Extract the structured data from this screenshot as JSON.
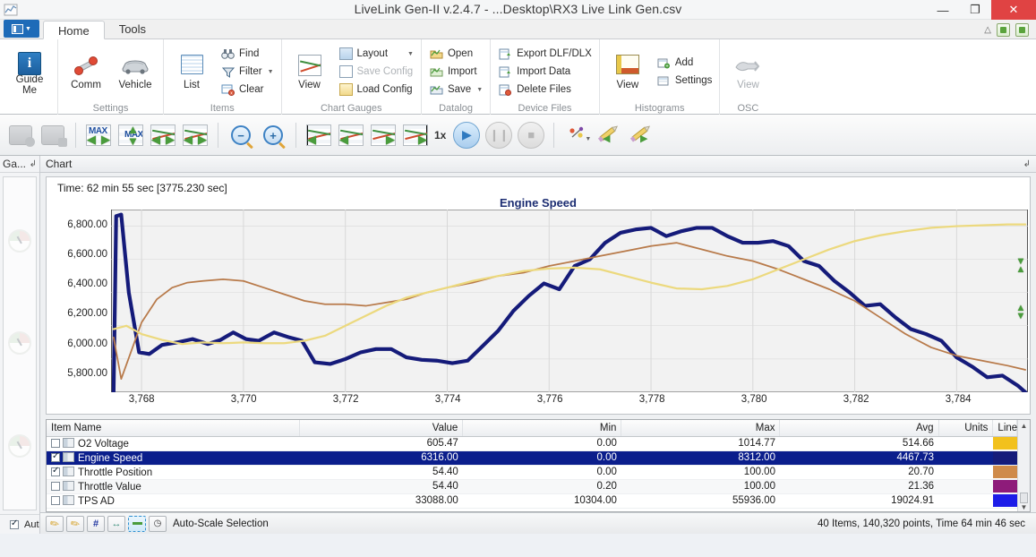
{
  "window": {
    "title": "LiveLink Gen-II  v.2.4.7 - ...Desktop\\RX3 Live Link Gen.csv",
    "minimize": "—",
    "maximize": "❐",
    "close": "✕"
  },
  "tabs": [
    {
      "label": "Home",
      "active": true
    },
    {
      "label": "Tools",
      "active": false
    }
  ],
  "ribbon": {
    "groups": [
      {
        "title": "",
        "big": [
          {
            "label": "Guide\nMe",
            "line1": "Guide",
            "line2": "Me",
            "icon": "info-icon",
            "dim": false
          }
        ],
        "small": []
      },
      {
        "title": "Settings",
        "big": [
          {
            "line1": "Comm",
            "line2": "",
            "icon": "connector-icon",
            "dim": false
          },
          {
            "line1": "Vehicle",
            "line2": "",
            "icon": "car-icon",
            "dim": false
          }
        ],
        "small": []
      },
      {
        "title": "Items",
        "big": [
          {
            "line1": "List",
            "line2": "",
            "icon": "list-icon",
            "dim": false
          }
        ],
        "small": [
          {
            "label": "Find",
            "icon": "binoculars-icon",
            "dim": false,
            "caret": false
          },
          {
            "label": "Filter",
            "icon": "funnel-icon",
            "dim": false,
            "caret": true
          },
          {
            "label": "Clear",
            "icon": "clear-icon",
            "dim": false,
            "caret": false
          }
        ]
      },
      {
        "title": "Chart  Gauges",
        "big": [
          {
            "line1": "View",
            "line2": "",
            "icon": "chart-view-icon",
            "dim": false
          }
        ],
        "small": [
          {
            "label": "Layout",
            "icon": "layout-icon",
            "dim": false,
            "caret": true
          },
          {
            "label": "Save Config",
            "icon": "save-config-icon",
            "dim": true,
            "caret": false
          },
          {
            "label": "Load Config",
            "icon": "load-config-icon",
            "dim": false,
            "caret": false
          }
        ]
      },
      {
        "title": "Datalog",
        "big": [],
        "small": [
          {
            "label": "Open",
            "icon": "open-icon",
            "dim": false,
            "caret": false
          },
          {
            "label": "Import",
            "icon": "import-icon",
            "dim": false,
            "caret": false
          },
          {
            "label": "Save",
            "icon": "save-icon",
            "dim": false,
            "caret": true
          }
        ]
      },
      {
        "title": "Device Files",
        "big": [],
        "small": [
          {
            "label": "Export DLF/DLX",
            "icon": "export-icon",
            "dim": false,
            "caret": false
          },
          {
            "label": "Import Data",
            "icon": "import-data-icon",
            "dim": false,
            "caret": false
          },
          {
            "label": "Delete Files",
            "icon": "delete-files-icon",
            "dim": false,
            "caret": false
          }
        ]
      },
      {
        "title": "Histograms",
        "big": [
          {
            "line1": "View",
            "line2": "",
            "icon": "histogram-icon",
            "dim": false
          }
        ],
        "small": [
          {
            "label": "Add",
            "icon": "add-icon",
            "dim": false,
            "caret": false
          },
          {
            "label": "Settings",
            "icon": "settings-icon",
            "dim": false,
            "caret": false
          }
        ]
      },
      {
        "title": "OSC",
        "big": [
          {
            "line1": "View",
            "line2": "",
            "icon": "osc-icon",
            "dim": true
          }
        ],
        "small": []
      }
    ]
  },
  "toolbar2": {
    "speed_label": "1x",
    "buttons": [
      "device-left-icon",
      "device-right-icon",
      "max-left-right-icon",
      "max-updown-icon",
      "chart-left-right-icon",
      "chart-expand-icon",
      "zoom-out-icon",
      "zoom-in-icon",
      "chart-start-icon",
      "chart-prev-icon",
      "chart-next-icon",
      "chart-end-icon",
      "play-icon",
      "pause-icon",
      "stop-icon",
      "marker-icon",
      "pencil-left-icon",
      "pencil-right-icon"
    ]
  },
  "gauges_panel": {
    "title": "Ga...",
    "pin": "↲",
    "auto_label": "Aut",
    "auto_checked": true
  },
  "chart_dock": {
    "title": "Chart",
    "pin": "↲"
  },
  "chart_data": {
    "type": "line",
    "title": "Engine Speed",
    "time_label": "Time: 62 min 55 sec [3775.230 sec]",
    "xlabel": "",
    "ylabel": "",
    "grid": true,
    "legend": "none",
    "ylim": [
      5800,
      6900
    ],
    "ytick_labels": [
      "6,800.00",
      "6,600.00",
      "6,400.00",
      "6,200.00",
      "6,000.00",
      "5,800.00"
    ],
    "ytick_values": [
      6800,
      6600,
      6400,
      6200,
      6000,
      5800
    ],
    "xlim": [
      3767.4,
      3785.4
    ],
    "xtick_labels": [
      "3,768",
      "3,770",
      "3,772",
      "3,774",
      "3,776",
      "3,778",
      "3,780",
      "3,782",
      "3,784"
    ],
    "xtick_values": [
      3768,
      3770,
      3772,
      3774,
      3776,
      3778,
      3780,
      3782,
      3784
    ],
    "series": [
      {
        "name": "Engine Speed",
        "color": "#151b7a",
        "width": 2.6,
        "x": [
          3767.45,
          3767.5,
          3767.6,
          3767.75,
          3767.95,
          3768.15,
          3768.4,
          3768.7,
          3769.0,
          3769.3,
          3769.55,
          3769.8,
          3770.05,
          3770.3,
          3770.6,
          3770.9,
          3771.15,
          3771.4,
          3771.7,
          3772.0,
          3772.3,
          3772.6,
          3772.9,
          3773.2,
          3773.5,
          3773.8,
          3774.1,
          3774.4,
          3774.7,
          3775.0,
          3775.3,
          3775.6,
          3775.9,
          3776.2,
          3776.5,
          3776.8,
          3777.1,
          3777.4,
          3777.7,
          3778.0,
          3778.3,
          3778.6,
          3778.9,
          3779.2,
          3779.5,
          3779.8,
          3780.1,
          3780.4,
          3780.7,
          3781.0,
          3781.3,
          3781.6,
          3781.9,
          3782.2,
          3782.5,
          3782.8,
          3783.1,
          3783.4,
          3783.7,
          3784.0,
          3784.3,
          3784.6,
          3784.9,
          3785.2,
          3785.35
        ],
        "y": [
          5800,
          6860,
          6870,
          6400,
          6040,
          6030,
          6085,
          6100,
          6120,
          6090,
          6115,
          6160,
          6120,
          6110,
          6160,
          6130,
          6110,
          5980,
          5970,
          6000,
          6040,
          6060,
          6060,
          6010,
          5995,
          5990,
          5975,
          5990,
          6080,
          6170,
          6290,
          6380,
          6455,
          6420,
          6560,
          6600,
          6700,
          6760,
          6780,
          6790,
          6740,
          6770,
          6790,
          6790,
          6740,
          6700,
          6700,
          6710,
          6680,
          6590,
          6560,
          6470,
          6400,
          6320,
          6330,
          6250,
          6180,
          6150,
          6110,
          6010,
          5955,
          5890,
          5900,
          5840,
          5800
        ]
      },
      {
        "name": "Throttle Position",
        "color": "#b87a4a",
        "width": 1.1,
        "x": [
          3767.45,
          3767.6,
          3767.8,
          3768.0,
          3768.3,
          3768.6,
          3768.9,
          3769.2,
          3769.6,
          3770.0,
          3770.4,
          3770.8,
          3771.2,
          3771.6,
          3772.0,
          3772.4,
          3772.8,
          3773.2,
          3773.6,
          3774.0,
          3774.5,
          3775.0,
          3775.5,
          3776.0,
          3776.5,
          3777.0,
          3777.5,
          3778.0,
          3778.5,
          3779.0,
          3779.5,
          3780.0,
          3780.5,
          3781.0,
          3781.5,
          3782.0,
          3782.5,
          3783.0,
          3783.5,
          3784.0,
          3784.5,
          3785.0,
          3785.35
        ],
        "y": [
          6130,
          5880,
          6050,
          6220,
          6360,
          6430,
          6460,
          6470,
          6480,
          6470,
          6430,
          6390,
          6350,
          6330,
          6330,
          6320,
          6340,
          6360,
          6400,
          6430,
          6460,
          6500,
          6520,
          6560,
          6590,
          6620,
          6650,
          6680,
          6700,
          6660,
          6620,
          6590,
          6540,
          6480,
          6420,
          6350,
          6250,
          6150,
          6070,
          6020,
          5990,
          5960,
          5935
        ]
      },
      {
        "name": "Throttle Value",
        "color": "#ecd97e",
        "width": 1.4,
        "x": [
          3767.45,
          3767.7,
          3768.0,
          3768.4,
          3768.8,
          3769.2,
          3769.6,
          3770.0,
          3770.4,
          3770.8,
          3771.2,
          3771.6,
          3772.0,
          3772.4,
          3772.8,
          3773.2,
          3773.6,
          3774.0,
          3774.5,
          3775.0,
          3775.5,
          3776.0,
          3776.5,
          3777.0,
          3777.5,
          3778.0,
          3778.5,
          3779.0,
          3779.5,
          3780.0,
          3780.5,
          3781.0,
          3781.5,
          3782.0,
          3782.5,
          3783.0,
          3783.5,
          3784.0,
          3784.5,
          3785.0,
          3785.35
        ],
        "y": [
          6180,
          6200,
          6150,
          6115,
          6090,
          6100,
          6095,
          6100,
          6095,
          6095,
          6110,
          6140,
          6200,
          6260,
          6320,
          6370,
          6400,
          6430,
          6470,
          6500,
          6530,
          6545,
          6550,
          6540,
          6500,
          6460,
          6425,
          6420,
          6440,
          6480,
          6540,
          6600,
          6660,
          6710,
          6745,
          6770,
          6790,
          6800,
          6805,
          6810,
          6810
        ]
      }
    ]
  },
  "table": {
    "columns": [
      {
        "key": "name",
        "label": "Item Name",
        "align": "left"
      },
      {
        "key": "value",
        "label": "Value",
        "align": "right"
      },
      {
        "key": "min",
        "label": "Min",
        "align": "right"
      },
      {
        "key": "max",
        "label": "Max",
        "align": "right"
      },
      {
        "key": "avg",
        "label": "Avg",
        "align": "right"
      },
      {
        "key": "units",
        "label": "Units",
        "align": "right"
      },
      {
        "key": "line",
        "label": "Line",
        "align": "right"
      }
    ],
    "rows": [
      {
        "checked": false,
        "selected": false,
        "name": "O2 Voltage",
        "value": "605.47",
        "min": "0.00",
        "max": "1014.77",
        "avg": "514.66",
        "units": "",
        "color": "#f2c11c"
      },
      {
        "checked": true,
        "selected": true,
        "name": "Engine Speed",
        "value": "6316.00",
        "min": "0.00",
        "max": "8312.00",
        "avg": "4467.73",
        "units": "",
        "color": "#151b7a"
      },
      {
        "checked": true,
        "selected": false,
        "name": "Throttle Position",
        "value": "54.40",
        "min": "0.00",
        "max": "100.00",
        "avg": "20.70",
        "units": "",
        "color": "#cf8a4a"
      },
      {
        "checked": false,
        "selected": false,
        "name": "Throttle Value",
        "value": "54.40",
        "min": "0.20",
        "max": "100.00",
        "avg": "21.36",
        "units": "",
        "color": "#8e1b7a"
      },
      {
        "checked": false,
        "selected": false,
        "name": "TPS AD",
        "value": "33088.00",
        "min": "10304.00",
        "max": "55936.00",
        "avg": "19024.91",
        "units": "",
        "color": "#1c1ce8"
      }
    ],
    "sort_indicator": "▲"
  },
  "statusbar": {
    "mode_label": "Auto-Scale Selection",
    "info": "40 Items, 140,320 points, Time 64 min 46 sec",
    "buttons": [
      "pencil-green-icon",
      "pencil-red-icon",
      "hash-icon",
      "fit-width-icon",
      "select-band-icon",
      "scale-icon"
    ]
  }
}
